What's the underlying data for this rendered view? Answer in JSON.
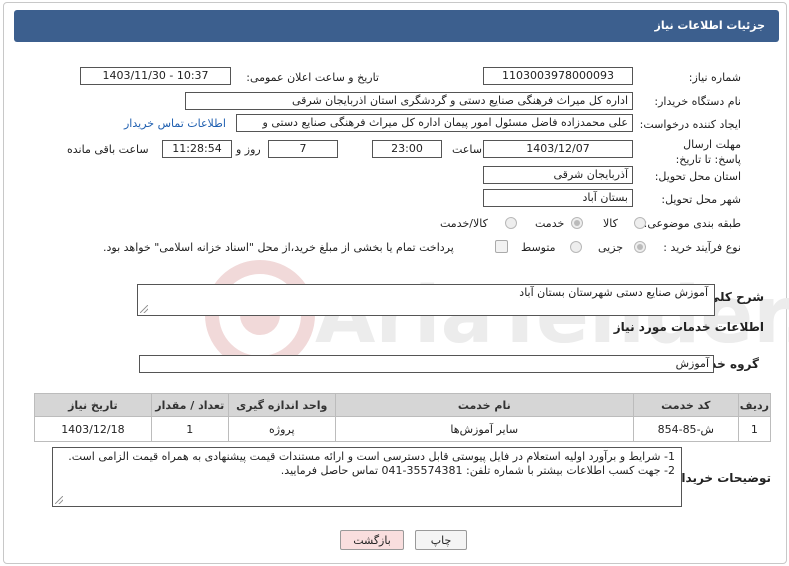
{
  "header": {
    "title": "جزئیات اطلاعات نیاز"
  },
  "fields": {
    "need_number_label": "شماره نیاز:",
    "need_number": "1103003978000093",
    "announce_label": "تاریخ و ساعت اعلان عمومی:",
    "announce_value": "1403/11/30 - 10:37",
    "buyer_org_label": "نام دستگاه خریدار:",
    "buyer_org": "اداره کل میراث فرهنگی  صنایع دستی و گردشگری استان اذربایجان شرقی",
    "requester_label": "ایجاد کننده درخواست:",
    "requester": "علی محمدزاده فاضل مسئول امور پیمان اداره کل میراث فرهنگی  صنایع دستی و",
    "contact_link": "اطلاعات تماس خریدار",
    "deadline_label": "مهلت ارسال پاسخ: تا تاریخ:",
    "deadline_date": "1403/12/07",
    "time_label": "ساعت",
    "deadline_time": "23:00",
    "days_value": "7",
    "days_label": "روز و",
    "remaining_time": "11:28:54",
    "remaining_label": "ساعت باقی مانده",
    "province_label": "استان محل تحویل:",
    "province": "آذربایجان شرقی",
    "city_label": "شهر محل تحویل:",
    "city": "بستان آباد",
    "category_label": "طبقه بندی موضوعی:",
    "category_options": [
      "کالا",
      "خدمت",
      "کالا/خدمت"
    ],
    "process_label": "نوع فرآیند خرید :",
    "process_options": [
      "جزیی",
      "متوسط"
    ],
    "payment_note": "پرداخت تمام یا بخشی از مبلغ خرید،از محل \"اسناد خزانه اسلامی\" خواهد بود."
  },
  "summary": {
    "label": "شرح کلی نیاز:",
    "value": "آموزش صنایع دستی شهرستان بستان آباد"
  },
  "services": {
    "section_title": "اطلاعات خدمات مورد نیاز",
    "group_label": "گروه خدمت:",
    "group_value": "آموزش",
    "columns": [
      "ردیف",
      "کد خدمت",
      "نام خدمت",
      "واحد اندازه گیری",
      "تعداد / مقدار",
      "تاریخ نیاز"
    ],
    "rows": [
      [
        "1",
        "ش-85-854",
        "سایر آموزش‌ها",
        "پروژه",
        "1",
        "1403/12/18"
      ]
    ]
  },
  "notes": {
    "label": "توضیحات خریدار:",
    "line1": "1- شرایط و برآورد اولیه استعلام در فایل پیوستی قابل دسترسی است و ارائه مستندات قیمت پیشنهادی به همراه قیمت الزامی است.",
    "line2": "2- جهت کسب اطلاعات بیشتر  با شماره تلفن: 35574381-041  تماس حاصل فرمایید."
  },
  "buttons": {
    "print": "چاپ",
    "back": "بازگشت"
  },
  "watermark": {
    "text": "AriaTender.neT"
  },
  "colors": {
    "header": "#3c5f8e",
    "link": "#1f5fb0",
    "back_button": "#f9dede"
  }
}
